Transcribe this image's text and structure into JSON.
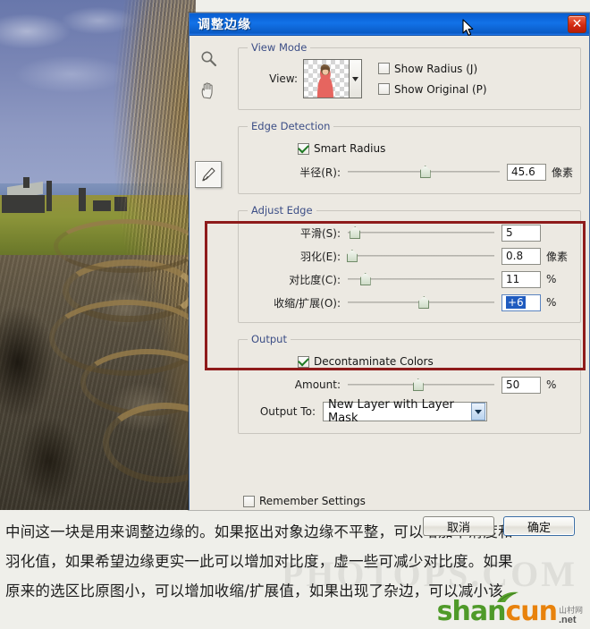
{
  "dialog": {
    "title": "调整边缘",
    "close_label": "✕",
    "tools": [
      {
        "name": "zoom-tool",
        "icon": "magnifier-icon",
        "selected": false
      },
      {
        "name": "hand-tool",
        "icon": "hand-icon",
        "selected": false
      },
      {
        "name": "refine-radius-brush-tool",
        "icon": "refine-brush-icon",
        "selected": true
      }
    ],
    "view_mode": {
      "legend": "View Mode",
      "view_label": "View:",
      "thumbnail_alt": "on-layers-preview",
      "checkboxes": [
        {
          "label": "Show Radius (J)",
          "checked": false
        },
        {
          "label": "Show Original (P)",
          "checked": false
        }
      ]
    },
    "edge_detection": {
      "legend": "Edge Detection",
      "smart_radius": {
        "label": "Smart Radius",
        "checked": true
      },
      "radius": {
        "label": "半径(R):",
        "value": "45.6",
        "unit": "像素",
        "slider_percent": 51
      }
    },
    "adjust_edge": {
      "legend": "Adjust Edge",
      "highlighted": true,
      "highlight_color": "#8e1b1b",
      "rows": [
        {
          "name": "smooth",
          "label": "平滑(S):",
          "value": "5",
          "unit": "",
          "slider_percent": 5,
          "selected": false
        },
        {
          "name": "feather",
          "label": "羽化(E):",
          "value": "0.8",
          "unit": "像素",
          "slider_percent": 3,
          "selected": false
        },
        {
          "name": "contrast",
          "label": "对比度(C):",
          "value": "11",
          "unit": "%",
          "slider_percent": 12,
          "selected": false
        },
        {
          "name": "shift-edge",
          "label": "收缩/扩展(O):",
          "value": "+6",
          "unit": "%",
          "slider_percent": 52,
          "selected": true
        }
      ]
    },
    "output": {
      "legend": "Output",
      "decontaminate": {
        "label": "Decontaminate Colors",
        "checked": true
      },
      "amount": {
        "label": "Amount:",
        "value": "50",
        "unit": "%",
        "slider_percent": 48
      },
      "output_to": {
        "label": "Output To:",
        "value": "New Layer with Layer Mask"
      }
    },
    "remember_settings": {
      "label": "Remember Settings",
      "checked": false
    },
    "buttons": {
      "cancel": "取消",
      "ok": "确定"
    }
  },
  "caption": {
    "line1": "中间这一块是用来调整边缘的。如果抠出对象边缘不平整，可以增加平滑度和",
    "line2": "羽化值，如果希望边缘更实一此可以增加对比度，虚一些可减少对比度。如果",
    "line3": "原来的选区比原图小，可以增加收缩/扩展值，如果出现了杂边，可以减小该"
  },
  "watermark": {
    "ghost": "PHOTOPS.COM",
    "shan": "shan",
    "cun": "cun",
    "cn": "山村网",
    "net": ".net"
  }
}
